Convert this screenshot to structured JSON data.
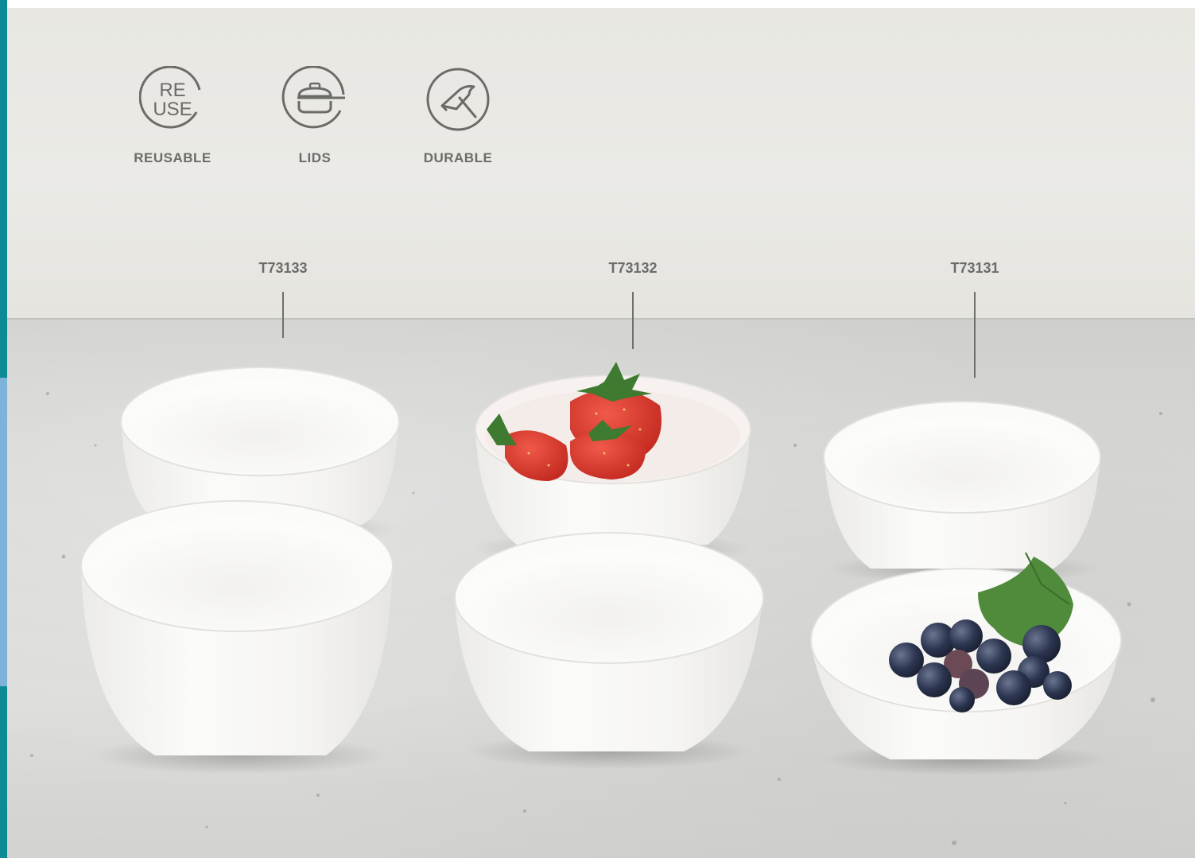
{
  "features": [
    {
      "label": "REUSABLE",
      "icon": "reuse-icon",
      "icon_text_top": "RE",
      "icon_text_bottom": "USE"
    },
    {
      "label": "LIDS",
      "icon": "lidded-container-icon"
    },
    {
      "label": "DURABLE",
      "icon": "hammer-icon"
    }
  ],
  "products": [
    {
      "code": "T73133"
    },
    {
      "code": "T73132"
    },
    {
      "code": "T73131"
    }
  ],
  "colors": {
    "text_gray": "#6b6b68",
    "edge_teal": "#0e8a96",
    "edge_light_blue": "#7db3d8",
    "wall": "#e9e8e4",
    "counter": "#d6d6d4",
    "strawberry": "#d9352b",
    "blueberry": "#2c3550"
  }
}
